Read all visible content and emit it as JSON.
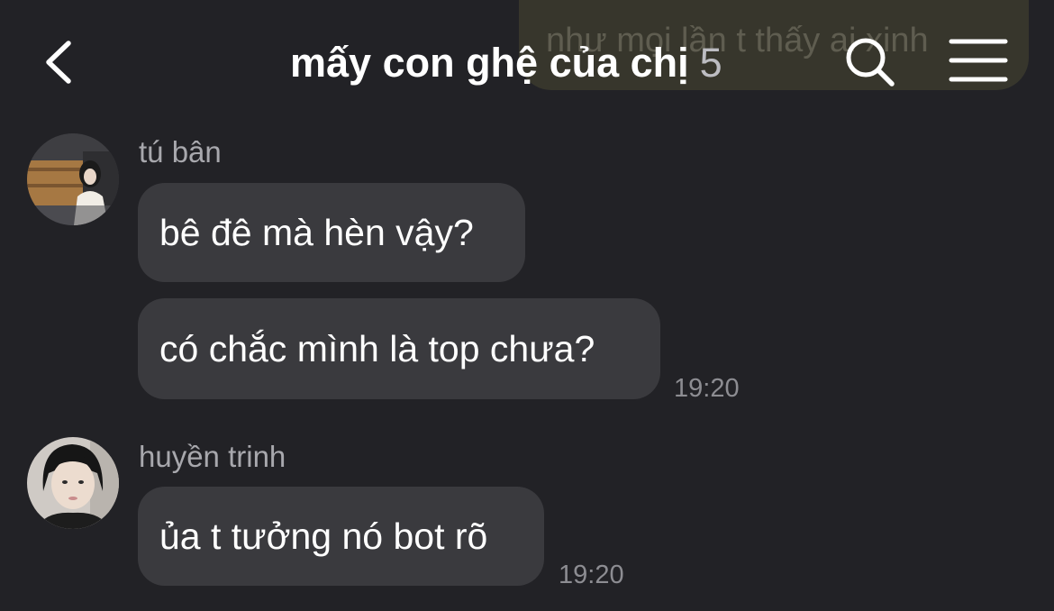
{
  "previous_message": {
    "text": "như mọi lần t thấy ai xinh"
  },
  "header": {
    "title": "mấy con ghệ của chị",
    "member_count": "5"
  },
  "messages": [
    {
      "sender": "tú bân",
      "bubbles": [
        {
          "text": "bê đê mà hèn vậy?"
        },
        {
          "text": "có chắc mình là top chưa?"
        }
      ],
      "time": "19:20"
    },
    {
      "sender": "huyền trinh",
      "bubbles": [
        {
          "text": "ủa t tưởng nó bot rõ"
        }
      ],
      "time": "19:20"
    }
  ],
  "colors": {
    "background": "#222226",
    "bubble": "#3a3a3e",
    "text": "#ffffff",
    "sender": "#a8a8ad",
    "time": "#8d8d92"
  },
  "icons": {
    "back": "chevron-left-icon",
    "search": "search-icon",
    "menu": "hamburger-menu-icon"
  }
}
